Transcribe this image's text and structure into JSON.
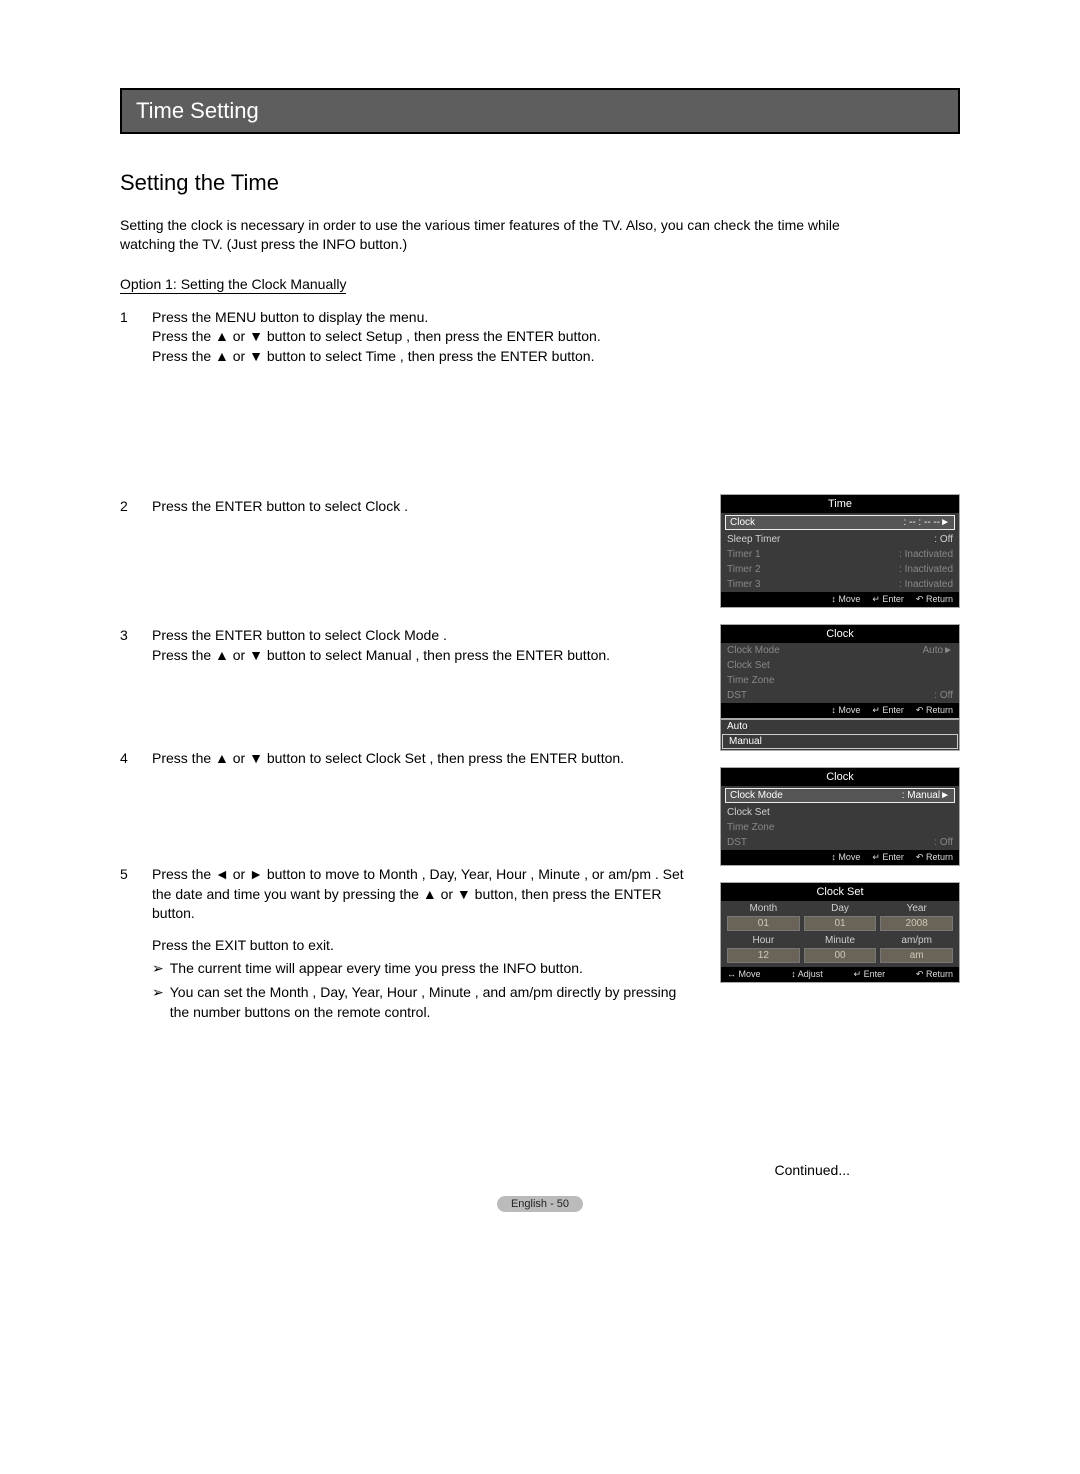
{
  "banner": "Time Setting",
  "section_title": "Setting the Time",
  "intro": "Setting the clock is necessary in order to use the various timer features of the TV. Also, you can check the time while watching the TV. (Just press the INFO button.)",
  "option1_label": "Option 1: Setting the Clock Manually",
  "steps": {
    "s1": {
      "n": "1",
      "l1": "Press the MENU button to display the menu.",
      "l2": "Press the ▲ or ▼ button to select Setup , then press the ENTER button.",
      "l3": "Press the ▲ or ▼ button to select Time , then press the ENTER button."
    },
    "s2": {
      "n": "2",
      "l1": "Press the ENTER button to select Clock ."
    },
    "s3": {
      "n": "3",
      "l1": "Press the ENTER button to select Clock Mode .",
      "l2": "Press the ▲ or ▼ button to select Manual , then press the ENTER button."
    },
    "s4": {
      "n": "4",
      "l1": "Press the ▲ or ▼ button to select Clock Set , then press the ENTER button."
    },
    "s5": {
      "n": "5",
      "l1": "Press the ◄ or ► button to move to Month , Day, Year, Hour , Minute , or am/pm . Set the date and time you want by pressing the ▲ or ▼ button, then press the ENTER button.",
      "l2": "Press the EXIT button to exit.",
      "n1": "The current time will appear every time you press the INFO button.",
      "n2": "You can set the Month , Day, Year, Hour , Minute , and am/pm  directly by pressing the number buttons on the remote control."
    }
  },
  "note_arrow": "➢",
  "continued": "Continued...",
  "footer": "English - 50",
  "osd_common": {
    "move": "Move",
    "enter": "Enter",
    "return": "Return",
    "adjust": "Adjust",
    "move_sym": "↕",
    "lr_sym": "↔",
    "enter_sym": "↵",
    "return_sym": "↶"
  },
  "osd2": {
    "title": "Time",
    "rows": [
      {
        "lab": "Clock",
        "val": ": -- : -- --",
        "sel": true,
        "chev": "►"
      },
      {
        "lab": "Sleep Timer",
        "val": ": Off"
      },
      {
        "lab": "Timer 1",
        "val": ": Inactivated",
        "dim": true
      },
      {
        "lab": "Timer 2",
        "val": ": Inactivated",
        "dim": true
      },
      {
        "lab": "Timer 3",
        "val": ": Inactivated",
        "dim": true
      }
    ]
  },
  "osd3": {
    "title": "Clock",
    "rows": [
      {
        "lab": "Clock Mode",
        "val": "Auto",
        "dim": true,
        "chev": "►"
      },
      {
        "lab": "Clock Set",
        "dim": true
      },
      {
        "lab": "Time Zone",
        "dim": true
      },
      {
        "lab": "DST",
        "val": ": Off",
        "dim": true
      }
    ],
    "dropdown": {
      "opt1": "Auto",
      "opt2": "Manual"
    }
  },
  "osd4": {
    "title": "Clock",
    "rows": [
      {
        "lab": "Clock Mode",
        "val": ": Manual",
        "sel": true,
        "chev": "►"
      },
      {
        "lab": "Clock Set"
      },
      {
        "lab": "Time Zone",
        "dim": true
      },
      {
        "lab": "DST",
        "val": ": Off",
        "dim": true
      }
    ]
  },
  "osd5": {
    "title": "Clock Set",
    "labels1": [
      "Month",
      "Day",
      "Year"
    ],
    "values1": [
      "01",
      "01",
      "2008"
    ],
    "labels2": [
      "Hour",
      "Minute",
      "am/pm"
    ],
    "values2": [
      "12",
      "00",
      "am"
    ]
  }
}
